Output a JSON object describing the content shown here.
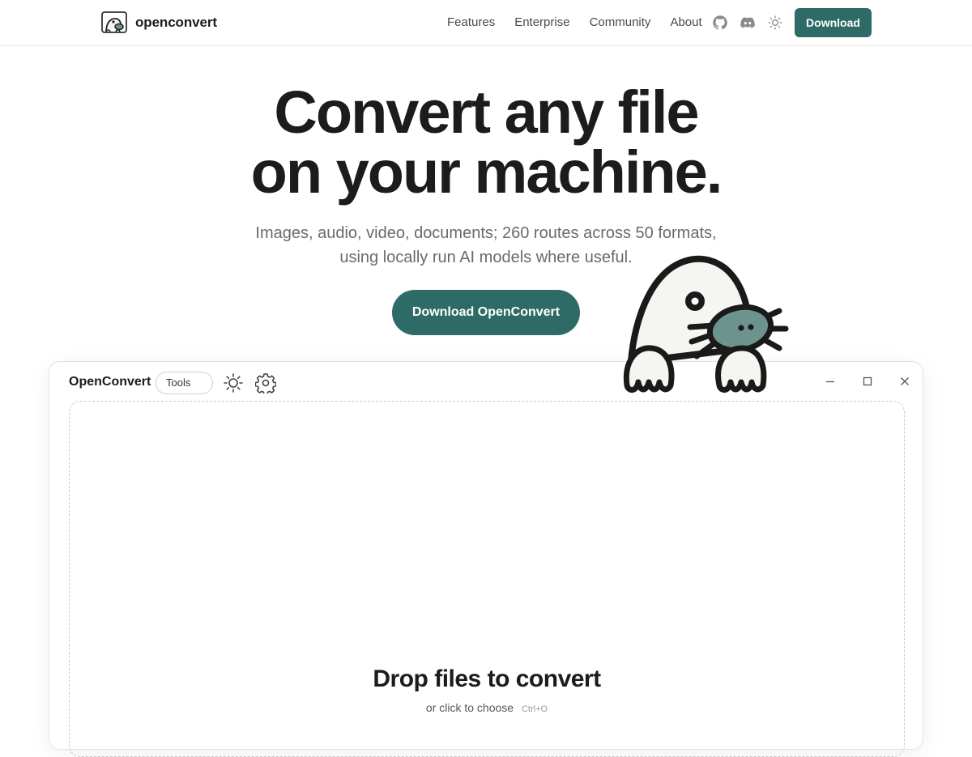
{
  "nav": {
    "brand": "openconvert",
    "links": [
      "Features",
      "Enterprise",
      "Community",
      "About"
    ],
    "icons": [
      "github-icon",
      "discord-icon",
      "theme-sun-icon"
    ],
    "download_label": "Download"
  },
  "hero": {
    "title_line1": "Convert any file",
    "title_line2": "on your machine.",
    "subtitle_line1": "Images, audio, video, documents; 260 routes across 50 formats,",
    "subtitle_line2": "using locally run AI models where useful.",
    "cta_label": "Download OpenConvert"
  },
  "app": {
    "title": "OpenConvert",
    "tools_label": "Tools",
    "toolbar_icons": [
      "sun-icon",
      "settings-gear-icon"
    ],
    "window_controls": [
      "minimize-icon",
      "maximize-icon",
      "close-icon"
    ],
    "dropzone": {
      "title": "Drop files to convert",
      "hint": "or click to choose",
      "shortcut": "Ctrl+O"
    }
  },
  "colors": {
    "accent": "#2f6b66",
    "mascot_nose": "#6d938f",
    "text_primary": "#1c1c1c",
    "text_muted": "#6a6a6a"
  }
}
